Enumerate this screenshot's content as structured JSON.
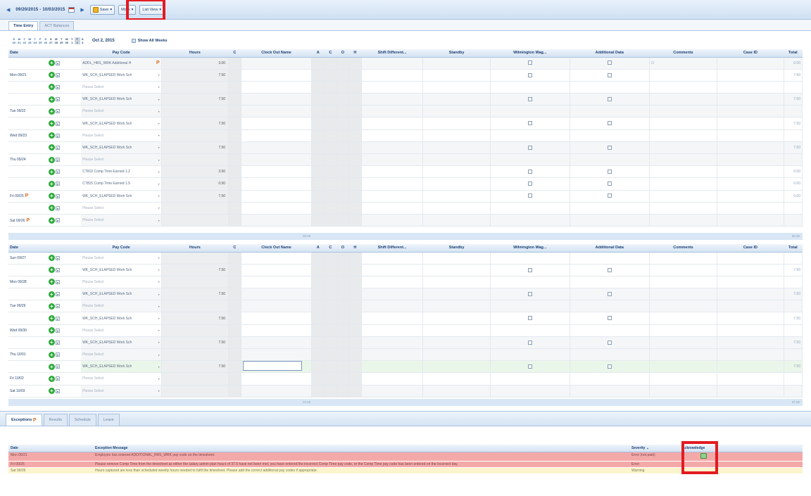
{
  "toolbar": {
    "date_range": "09/20/2015 - 10/03/2015",
    "save_label": "Save",
    "more_label": "More",
    "list_view_label": "List View"
  },
  "tabs_top": [
    {
      "label": "Time Entry"
    },
    {
      "label": "ACT Balances"
    }
  ],
  "week_selector": {
    "day_letters": [
      "S",
      "M",
      "T",
      "W",
      "T",
      "F",
      "S",
      "S",
      "M",
      "T",
      "W",
      "T",
      "F",
      "S"
    ],
    "day_numbers": [
      "20",
      "21",
      "22",
      "23",
      "24",
      "25",
      "26",
      "27",
      "28",
      "29",
      "30",
      "1",
      "2",
      "3"
    ],
    "current_date": "Oct 2, 2015",
    "show_all_weeks": "Show All Weeks"
  },
  "columns": [
    "Date",
    "Pay Code",
    "Hours",
    "C",
    "Clock Out Name",
    "A",
    "C",
    "O",
    "H",
    "Shift Different...",
    "Standby",
    "Wilmington Wag...",
    "Additional Data",
    "Comments",
    "Case ID",
    "Total"
  ],
  "week1": {
    "rows": [
      {
        "date": "",
        "pay_code": "ADDL_HRS_WRK Additional H",
        "hours": "3.00",
        "total": "0.00",
        "wil": true,
        "add": true,
        "comment": "☐",
        "flag": true,
        "alt": true
      },
      {
        "date": "Mon 09/21",
        "pay_code": "WK_SCH_ELAPSED Work Sch",
        "hours": "7.50",
        "total": "7.50",
        "wil": true,
        "add": false
      },
      {
        "date": "",
        "pay_code": "Please Select",
        "hours": "",
        "total": "",
        "ph": true
      },
      {
        "date": "",
        "pay_code": "WK_SCH_ELAPSED Work Sch",
        "hours": "7.50",
        "total": "7.50",
        "wil": true,
        "add": false,
        "alt": true
      },
      {
        "date": "Tue 09/22",
        "pay_code": "Please Select",
        "hours": "",
        "total": "",
        "ph": true,
        "alt": true
      },
      {
        "date": "",
        "pay_code": "WK_SCH_ELAPSED Work Sch",
        "hours": "7.50",
        "total": "7.50",
        "wil": true,
        "add": false
      },
      {
        "date": "Wed 09/23",
        "pay_code": "Please Select",
        "hours": "",
        "total": "",
        "ph": true
      },
      {
        "date": "",
        "pay_code": "WK_SCH_ELAPSED Work Sch",
        "hours": "7.50",
        "total": "7.50",
        "wil": true,
        "add": false,
        "alt": true
      },
      {
        "date": "Thu 09/24",
        "pay_code": "Please Select",
        "hours": "",
        "total": "",
        "ph": true,
        "alt": true
      },
      {
        "date": "",
        "pay_code": "CT810 Comp Time Earned 1.2",
        "hours": "3.50",
        "total": "0.00",
        "wil": true,
        "add": true
      },
      {
        "date": "",
        "pay_code": "CT815 Comp Time Earned 1.5",
        "hours": "0.50",
        "total": "0.00",
        "wil": true,
        "add": true
      },
      {
        "date": "Fri 09/25",
        "pay_code": "WK_SCH_ELAPSED Work Sch",
        "hours": "7.50",
        "total": "0.00",
        "wil": true,
        "add": true,
        "flag": true
      },
      {
        "date": "",
        "pay_code": "Please Select",
        "hours": "",
        "total": "",
        "ph": true
      },
      {
        "date": "Sat 09/26",
        "pay_code": "Please Select",
        "hours": "",
        "total": "",
        "ph": true,
        "alt": true,
        "flag": true
      }
    ],
    "hours_total": "30.00",
    "grand_total": "30.00"
  },
  "week2": {
    "rows": [
      {
        "date": "Sun 09/27",
        "pay_code": "Please Select",
        "hours": "",
        "total": "",
        "ph": true
      },
      {
        "date": "",
        "pay_code": "WK_SCH_ELAPSED Work Sch",
        "hours": "7.50",
        "total": "7.50",
        "wil": true,
        "add": false
      },
      {
        "date": "Mon 09/28",
        "pay_code": "Please Select",
        "hours": "",
        "total": "",
        "ph": true
      },
      {
        "date": "",
        "pay_code": "WK_SCH_ELAPSED Work Sch",
        "hours": "7.50",
        "total": "7.50",
        "wil": true,
        "add": false,
        "alt": true
      },
      {
        "date": "Tue 09/29",
        "pay_code": "Please Select",
        "hours": "",
        "total": "",
        "ph": true,
        "alt": true
      },
      {
        "date": "",
        "pay_code": "WK_SCH_ELAPSED Work Sch",
        "hours": "7.50",
        "total": "7.50",
        "wil": true,
        "add": false
      },
      {
        "date": "Wed 09/30",
        "pay_code": "Please Select",
        "hours": "",
        "total": "",
        "ph": true
      },
      {
        "date": "",
        "pay_code": "WK_SCH_ELAPSED Work Sch",
        "hours": "7.50",
        "total": "7.50",
        "wil": true,
        "add": false,
        "alt": true
      },
      {
        "date": "Thu 10/01",
        "pay_code": "Please Select",
        "hours": "",
        "total": "",
        "ph": true,
        "alt": true
      },
      {
        "date": "",
        "pay_code": "WK_SCH_ELAPSED Work Sch",
        "hours": "7.50",
        "total": "7.50",
        "wil": true,
        "add": false,
        "green": true,
        "edit": true
      },
      {
        "date": "Fri 10/02",
        "pay_code": "Please Select",
        "hours": "",
        "total": "",
        "ph": true
      },
      {
        "date": "Sat 10/03",
        "pay_code": "Please Select",
        "hours": "",
        "total": "",
        "ph": true,
        "alt": true
      }
    ],
    "hours_total": "37.50",
    "grand_total": "37.50"
  },
  "tabs_bottom": [
    {
      "label": "Exceptions"
    },
    {
      "label": "Results"
    },
    {
      "label": "Schedule"
    },
    {
      "label": "Leave"
    }
  ],
  "exceptions": {
    "columns": [
      "Date",
      "Exception Message",
      "Severity",
      "Acknowledge"
    ],
    "rows": [
      {
        "date": "Mon 09/21",
        "message": "Employee has entered ADDITIONAL_HRS_WRK pay code on the timesheet.",
        "severity": "Error (not paid)",
        "type": "err",
        "ack": true
      },
      {
        "date": "Fri 09/25",
        "message": "Please remove Comp Time from the timesheet as either the salary admin plan hours of 37.5 have not been met, you have entered the incorrect Comp Time pay code, or the Comp Time pay code has been entered on the incorrect day.",
        "severity": "Error",
        "type": "err",
        "ack": false
      },
      {
        "date": "Sat 09/26",
        "message": "Hours captured are less than scheduled weekly hours needed to fulfil the timesheet. Please add the correct additional pay codes if appropriate.",
        "severity": "Warning",
        "type": "warn",
        "ack": false
      }
    ]
  },
  "colors": {
    "highlight": "#e21b22",
    "header_blue": "#d5e3f2",
    "error_row": "#f4a9a9",
    "warning_row": "#fbf4cc",
    "add_green": "#2eaa3a"
  }
}
